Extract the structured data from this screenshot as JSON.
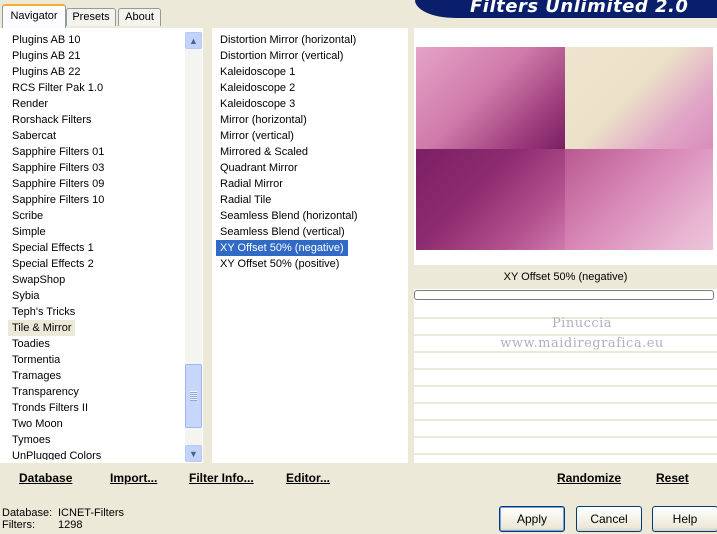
{
  "tabs": [
    {
      "label": "Navigator",
      "active": true
    },
    {
      "label": "Presets",
      "active": false
    },
    {
      "label": "About",
      "active": false
    }
  ],
  "banner_title": "Filters Unlimited 2.0",
  "categories": {
    "items": [
      "Plugins AB 10",
      "Plugins AB 21",
      "Plugins AB 22",
      "RCS Filter Pak 1.0",
      "Render",
      "Rorshack Filters",
      "Sabercat",
      "Sapphire Filters 01",
      "Sapphire Filters 03",
      "Sapphire Filters 09",
      "Sapphire Filters 10",
      "Scribe",
      "Simple",
      "Special Effects 1",
      "Special Effects 2",
      "SwapShop",
      "Sybia",
      "Teph's Tricks",
      "Tile & Mirror",
      "Toadies",
      "Tormentia",
      "Tramages",
      "Transparency",
      "Tronds Filters II",
      "Two Moon",
      "Tymoes",
      "UnPlugged Colors"
    ],
    "selected": "Tile & Mirror"
  },
  "filters": {
    "items": [
      "Distortion Mirror (horizontal)",
      "Distortion Mirror (vertical)",
      "Kaleidoscope 1",
      "Kaleidoscope 2",
      "Kaleidoscope 3",
      "Mirror (horizontal)",
      "Mirror (vertical)",
      "Mirrored & Scaled",
      "Quadrant Mirror",
      "Radial Mirror",
      "Radial Tile",
      "Seamless Blend (horizontal)",
      "Seamless Blend (vertical)",
      "XY Offset 50% (negative)",
      "XY Offset 50% (positive)"
    ],
    "selected": "XY Offset 50% (negative)"
  },
  "preview": {
    "filter_name": "XY Offset 50% (negative)",
    "watermark_line1": "Pinuccia",
    "watermark_line2": "www.maidiregrafica.eu",
    "colors": {
      "dark_plum": "#7a1e63",
      "pink": "#d98dbb",
      "cream": "#efe5cf"
    }
  },
  "links": {
    "database": "Database",
    "import": "Import...",
    "filter_info": "Filter Info...",
    "editor": "Editor...",
    "randomize": "Randomize",
    "reset": "Reset"
  },
  "status": {
    "database_label": "Database:",
    "database_value": "ICNET-Filters",
    "filters_label": "Filters:",
    "filters_value": "1298"
  },
  "buttons": {
    "apply": "Apply",
    "cancel": "Cancel",
    "help": "Help"
  },
  "icons": {
    "scroll_up": "▲",
    "scroll_down": "▼"
  }
}
